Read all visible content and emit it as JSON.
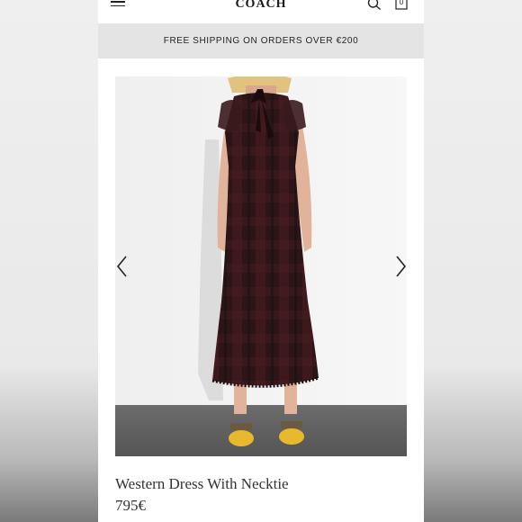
{
  "header": {
    "logo": "COACH",
    "bag_count": "0"
  },
  "banner": {
    "text": "FREE SHIPPING ON ORDERS OVER €200"
  },
  "product": {
    "name": "Western Dress With Necktie",
    "price": "795€"
  },
  "icons": {
    "menu": "hamburger-menu-icon",
    "search": "search-icon",
    "bag": "shopping-bag-icon",
    "prev": "chevron-left-icon",
    "next": "chevron-right-icon"
  },
  "colors": {
    "banner_bg": "#e4e4e4",
    "dress": "#2e1518",
    "shoes": "#e8b92f"
  }
}
